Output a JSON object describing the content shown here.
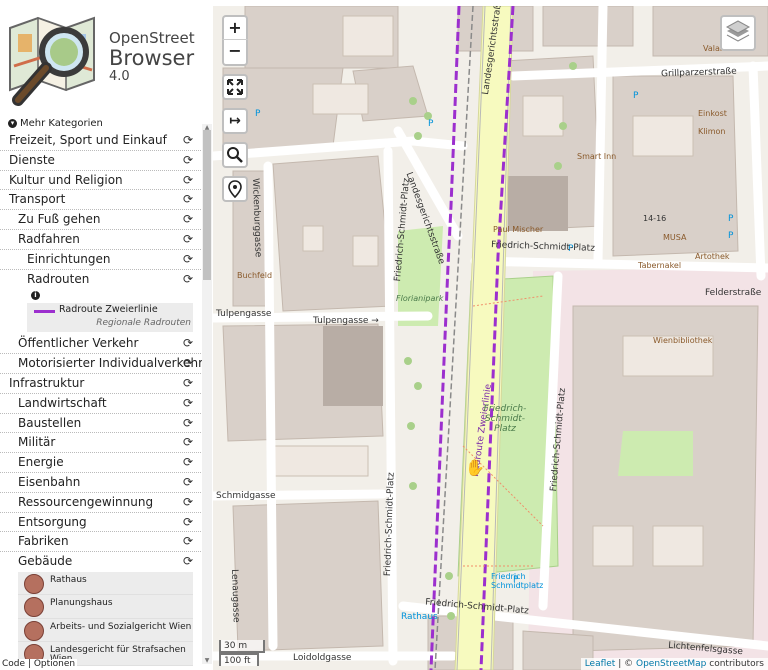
{
  "app": {
    "name_line1": "OpenStreet",
    "name_line2": "Browser",
    "version": "4.0"
  },
  "sidebar": {
    "more_categories": "Mehr Kategorien",
    "categories": [
      {
        "label": "Freizeit, Sport und Einkauf"
      },
      {
        "label": "Dienste"
      },
      {
        "label": "Kultur und Religion"
      },
      {
        "label": "Transport"
      },
      {
        "label": "Zu Fuß gehen"
      },
      {
        "label": "Radfahren"
      },
      {
        "label": "Einrichtungen"
      },
      {
        "label": "Radrouten"
      },
      {
        "label": "Öffentlicher Verkehr"
      },
      {
        "label": "Motorisierter Individualverkehr"
      },
      {
        "label": "Infrastruktur"
      },
      {
        "label": "Landwirtschaft"
      },
      {
        "label": "Baustellen"
      },
      {
        "label": "Militär"
      },
      {
        "label": "Energie"
      },
      {
        "label": "Eisenbahn"
      },
      {
        "label": "Ressourcengewinnung"
      },
      {
        "label": "Entsorgung"
      },
      {
        "label": "Fabriken"
      },
      {
        "label": "Gebäude"
      }
    ],
    "legend": {
      "name": "Radroute Zweierlinie",
      "sub": "Regionale Radrouten",
      "color": "#9c2fce"
    },
    "pois": [
      {
        "name": "Rathaus"
      },
      {
        "name": "Planungshaus"
      },
      {
        "name": "Arbeits- und Sozialgericht Wien"
      },
      {
        "name": "Landesgericht für Strafsachen",
        "name2": "Wien"
      }
    ],
    "footer_code": "Code",
    "footer_sep": "|",
    "footer_options": "Optionen"
  },
  "map": {
    "zoom_in": "+",
    "zoom_out": "−",
    "scale_metric": "30 m",
    "scale_imperial": "100 ft",
    "attribution_leaflet": "Leaflet",
    "attribution_sep": "| ©",
    "attribution_osm": "OpenStreetMap",
    "attribution_tail": "contributors",
    "labels": {
      "landesgerichtsstrasse_top": "Landesgerichtsstraße",
      "landesgerichtsstrasse_mid": "Landesgerichtsstraße",
      "grillparzerstrasse": "Grillparzerstraße",
      "wickenburggasse": "Wickenburggasse",
      "fs_platz_top": "Friedrich-Schmidt-Platz",
      "fs_platz_east": "Friedrich-Schmidt-Platz",
      "fs_platz_right": "Friedrich-Schmidt-Platz",
      "fs_platz_left_v": "Friedrich-Schmidt-Platz",
      "fs_platz_bottom": "Friedrich-Schmidt-Platz",
      "felderstrasse": "Felderstraße",
      "tulpengasse_1": "Tulpengasse",
      "tulpengasse_2": "Tulpengasse →",
      "schmidgasse": "Schmidgasse",
      "lenaugasse": "Lenaugasse",
      "loidoldgasse": "Loidoldgasse",
      "lichtenfelsgasse": "Lichtenfelsgasse",
      "zweierlinie": "Radroute Zweierlinie",
      "park_name": "Friedrich-Schmidt-Platz",
      "rathaus": "Rathaus",
      "fs_platz_small": "Friedrich Schmidtplatz",
      "wienbibliothek": "Wienbibliothek",
      "musa": "MUSA",
      "tabernakel": "Tabernakel",
      "artothek": "Artothek",
      "paul_mischer": "Paul Mischer",
      "buchfeld": "Buchfeld",
      "florianipark": "Florianipark",
      "einkost": "Einkost",
      "klimon": "Klimon",
      "smart_inn": "Smart Inn",
      "valartis": "Valartis",
      "num_14_16": "14-16"
    }
  }
}
